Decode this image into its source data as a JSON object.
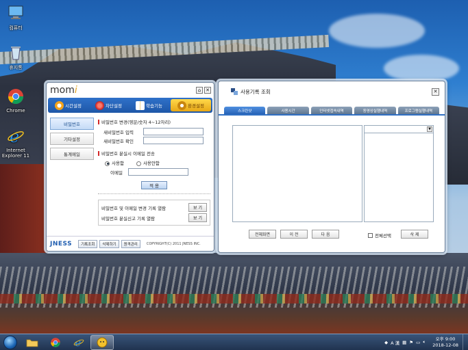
{
  "desktop": {
    "icons": [
      {
        "label": "컴퓨터",
        "icon": "computer-icon"
      },
      {
        "label": "휴지통",
        "icon": "recycle-bin-icon"
      },
      {
        "label": "Chrome",
        "icon": "chrome-icon"
      },
      {
        "label": "Internet Explorer 11",
        "icon": "ie-icon"
      }
    ]
  },
  "momi": {
    "logo": "momi",
    "tabs": [
      {
        "label": "시간설정",
        "icon": "clock-icon"
      },
      {
        "label": "차단설정",
        "icon": "block-icon"
      },
      {
        "label": "학습기능",
        "icon": "book-icon"
      },
      {
        "label": "환경설정",
        "icon": "settings-icon"
      }
    ],
    "active_tab": "환경설정",
    "side": [
      "비밀번호",
      "기타설정",
      "통계메일"
    ],
    "password": {
      "title": "비밀번호 변경(영문/숫자 4~12자리)",
      "new_label": "새비밀번호 입력",
      "confirm_label": "새비밀번호 확인"
    },
    "email": {
      "title": "비밀번호 분실시 이메일 전송",
      "use": "사용함",
      "no_use": "사용안함",
      "selected": "사용함",
      "email_label": "이메일"
    },
    "apply": "적 용",
    "logs": [
      {
        "label": "비밀번호 및 이메일 변경 기록 열람",
        "button": "보 기"
      },
      {
        "label": "비밀번호 분실신고 기록 열람",
        "button": "보 기"
      }
    ],
    "footer": {
      "brand": "JNESS",
      "buttons": [
        "기록조회",
        "삭제하기",
        "원격관리"
      ],
      "copyright": "COPYRIGHT(C) 2011 JNESS INC."
    }
  },
  "usage": {
    "title": "사용기록 조회",
    "tabs": [
      "스크린샷",
      "사용시간",
      "인터넷접속내역",
      "동영상실행내역",
      "프로그램실행내역"
    ],
    "active_tab": "스크린샷",
    "buttons": [
      "전체화면",
      "이 전",
      "다 음"
    ],
    "select_all": "전체선택",
    "delete": "삭 제"
  },
  "taskbar": {
    "items": [
      {
        "icon": "folder-icon"
      },
      {
        "icon": "chrome-icon"
      },
      {
        "icon": "ie-icon"
      },
      {
        "icon": "momi-app-icon"
      }
    ],
    "ime": "A 漢",
    "time": "오후 9:00",
    "date": "2018-12-08"
  },
  "colors": {
    "accent": "#2f6fc3",
    "active_tab": "#e8a817",
    "bullet": "#d42828"
  }
}
